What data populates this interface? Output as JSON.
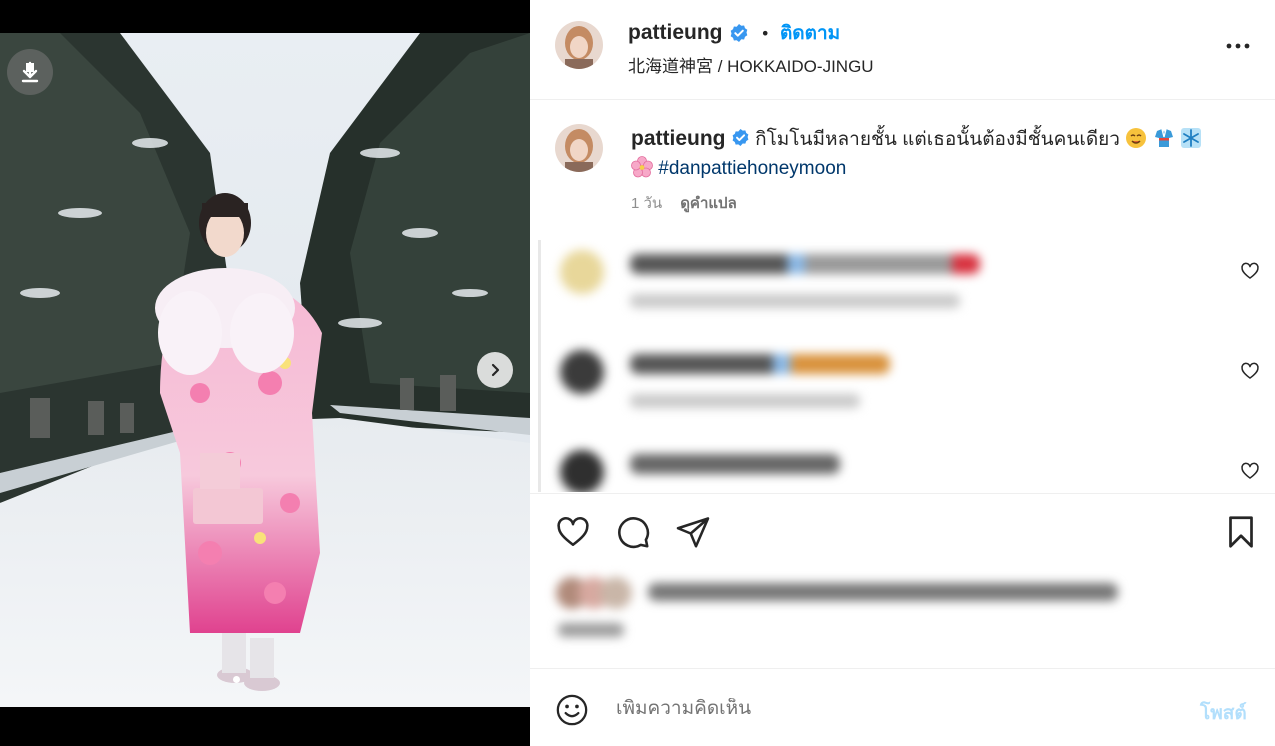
{
  "post": {
    "username": "pattieung",
    "follow_label": "ติดตาม",
    "separator": "•",
    "location": "北海道神宮 / HOKKAIDO-JINGU"
  },
  "caption": {
    "username": "pattieung",
    "text": "กิโมโนมีหลายชั้น แต่เธอนั้นต้องมีชั้นคนเดียว",
    "hashtag": "#danpattiehoneymoon",
    "time": "1 วัน",
    "translate_label": "ดูคำแปล"
  },
  "comment_input": {
    "placeholder": "เพิ่มความคิดเห็น",
    "post_label": "โพสต์"
  },
  "colors": {
    "link_blue": "#0095f6",
    "post_disabled": "#b2dffc",
    "verified_blue": "#3897f0"
  },
  "icons": [
    "download-icon",
    "chevron-right-icon",
    "verified-badge-icon",
    "more-icon",
    "heart-icon",
    "comment-icon",
    "share-icon",
    "bookmark-icon",
    "emoji-icon"
  ]
}
